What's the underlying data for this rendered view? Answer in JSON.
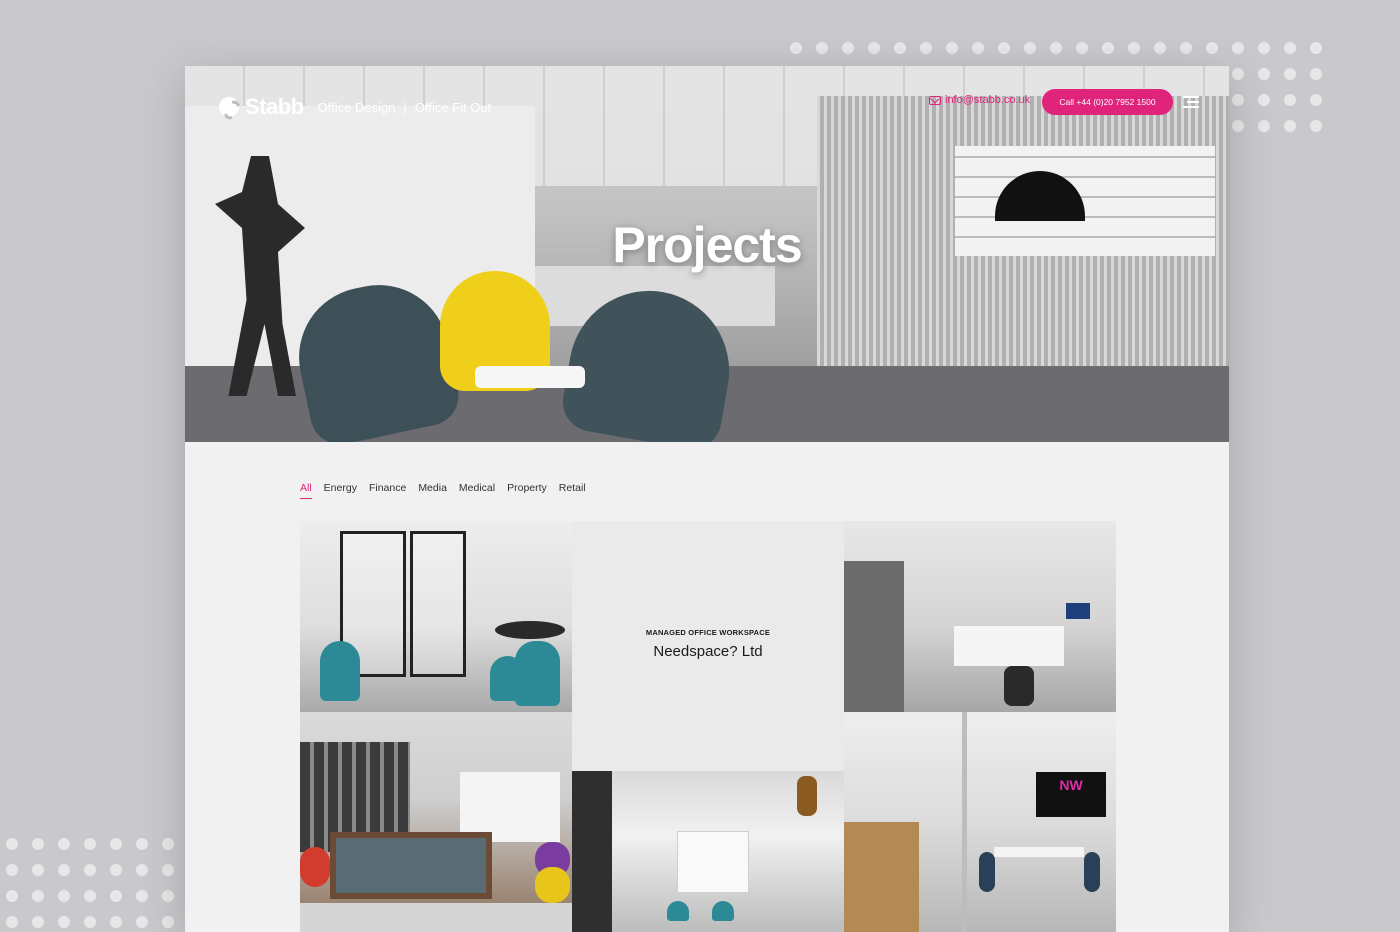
{
  "header": {
    "brand": "Stabb",
    "tagline_left": "Office Design",
    "tagline_sep": "|",
    "tagline_right": "Office Fit Out",
    "email": "info@stabb.co.uk",
    "call_label": "Call +44 (0)20 7952 1500"
  },
  "hero": {
    "title": "Projects"
  },
  "filters": [
    {
      "label": "All",
      "active": true
    },
    {
      "label": "Energy",
      "active": false
    },
    {
      "label": "Finance",
      "active": false
    },
    {
      "label": "Media",
      "active": false
    },
    {
      "label": "Medical",
      "active": false
    },
    {
      "label": "Property",
      "active": false
    },
    {
      "label": "Retail",
      "active": false
    }
  ],
  "projects": {
    "featured": {
      "category": "MANAGED OFFICE WORKSPACE",
      "name": "Needspace? Ltd"
    },
    "tv_logo": "NW"
  },
  "colors": {
    "accent": "#e0247b",
    "background": "#c9c9cd",
    "page": "#f1f1f1"
  },
  "icons": [
    "stabb-logo-icon",
    "mail-icon",
    "menu-icon"
  ]
}
